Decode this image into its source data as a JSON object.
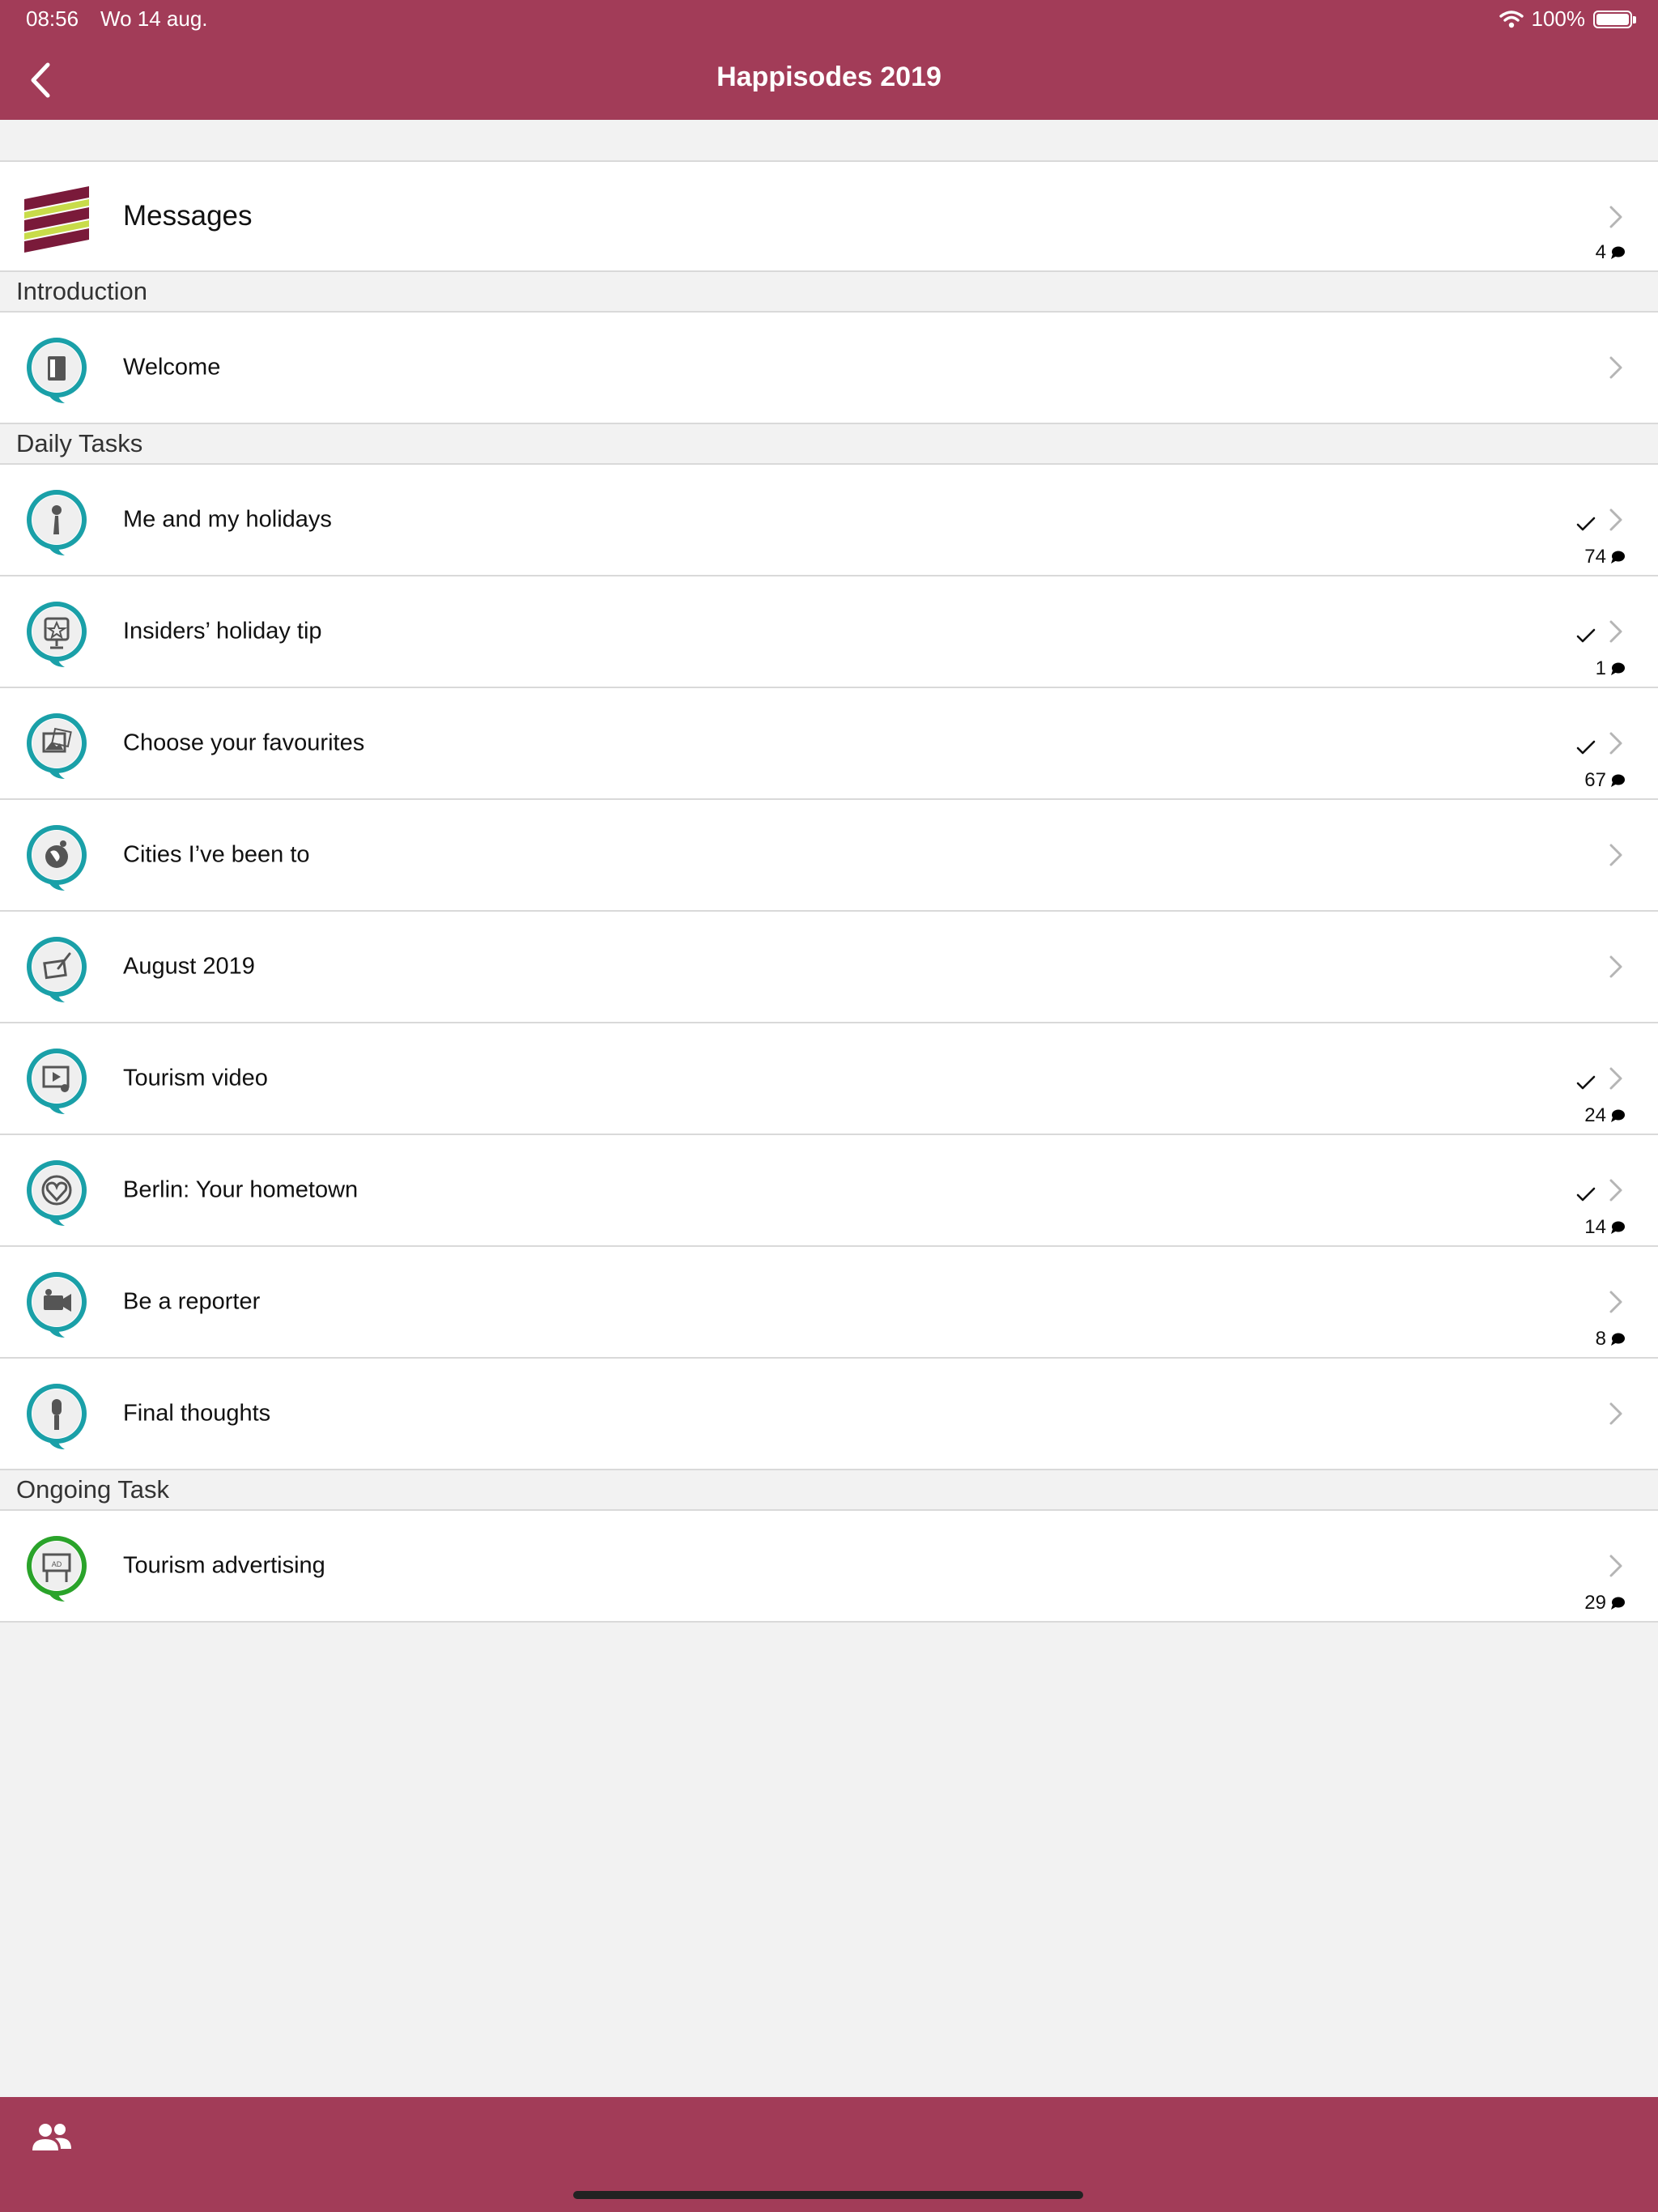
{
  "status_bar": {
    "time": "08:56",
    "date": "Wo 14 aug.",
    "battery_percent": "100%",
    "battery_level": 1.0
  },
  "nav": {
    "title": "Happisodes 2019"
  },
  "messages": {
    "label": "Messages",
    "count": "4"
  },
  "sections": [
    {
      "title": "Introduction",
      "items": [
        {
          "label": "Welcome",
          "icon": "door-icon",
          "done": false,
          "count": ""
        }
      ]
    },
    {
      "title": "Daily Tasks",
      "items": [
        {
          "label": "Me and my holidays",
          "icon": "person-globe-icon",
          "done": true,
          "count": "74"
        },
        {
          "label": "Insiders’ holiday tip",
          "icon": "star-sign-icon",
          "done": true,
          "count": "1"
        },
        {
          "label": "Choose your favourites",
          "icon": "photos-icon",
          "done": true,
          "count": "67"
        },
        {
          "label": "Cities I’ve been to",
          "icon": "globe-pin-icon",
          "done": false,
          "count": ""
        },
        {
          "label": "August 2019",
          "icon": "drawing-pad-icon",
          "done": false,
          "count": ""
        },
        {
          "label": "Tourism video",
          "icon": "film-play-icon",
          "done": true,
          "count": "24"
        },
        {
          "label": "Berlin: Your hometown",
          "icon": "heart-badge-icon",
          "done": true,
          "count": "14"
        },
        {
          "label": "Be a reporter",
          "icon": "video-camera-icon",
          "done": false,
          "count": "8"
        },
        {
          "label": "Final thoughts",
          "icon": "microphone-icon",
          "done": false,
          "count": ""
        }
      ]
    },
    {
      "title": "Ongoing Task",
      "items": [
        {
          "label": "Tourism advertising",
          "icon": "billboard-ad-icon",
          "done": false,
          "count": "29",
          "ring": "green"
        }
      ]
    }
  ],
  "tabbar": {
    "icon": "people-icon"
  },
  "colors": {
    "brand": "#a23c58",
    "teal_ring": "#1aa0a8",
    "green_ring": "#2aa32a",
    "logo_dark": "#7a1a3a",
    "logo_lime": "#c8dc4a"
  },
  "icons": {
    "back": "chevron-left-icon",
    "chevron": "chevron-right-icon",
    "check": "checkmark-icon",
    "comment": "speech-bubble-icon",
    "wifi": "wifi-icon",
    "battery": "battery-icon"
  }
}
